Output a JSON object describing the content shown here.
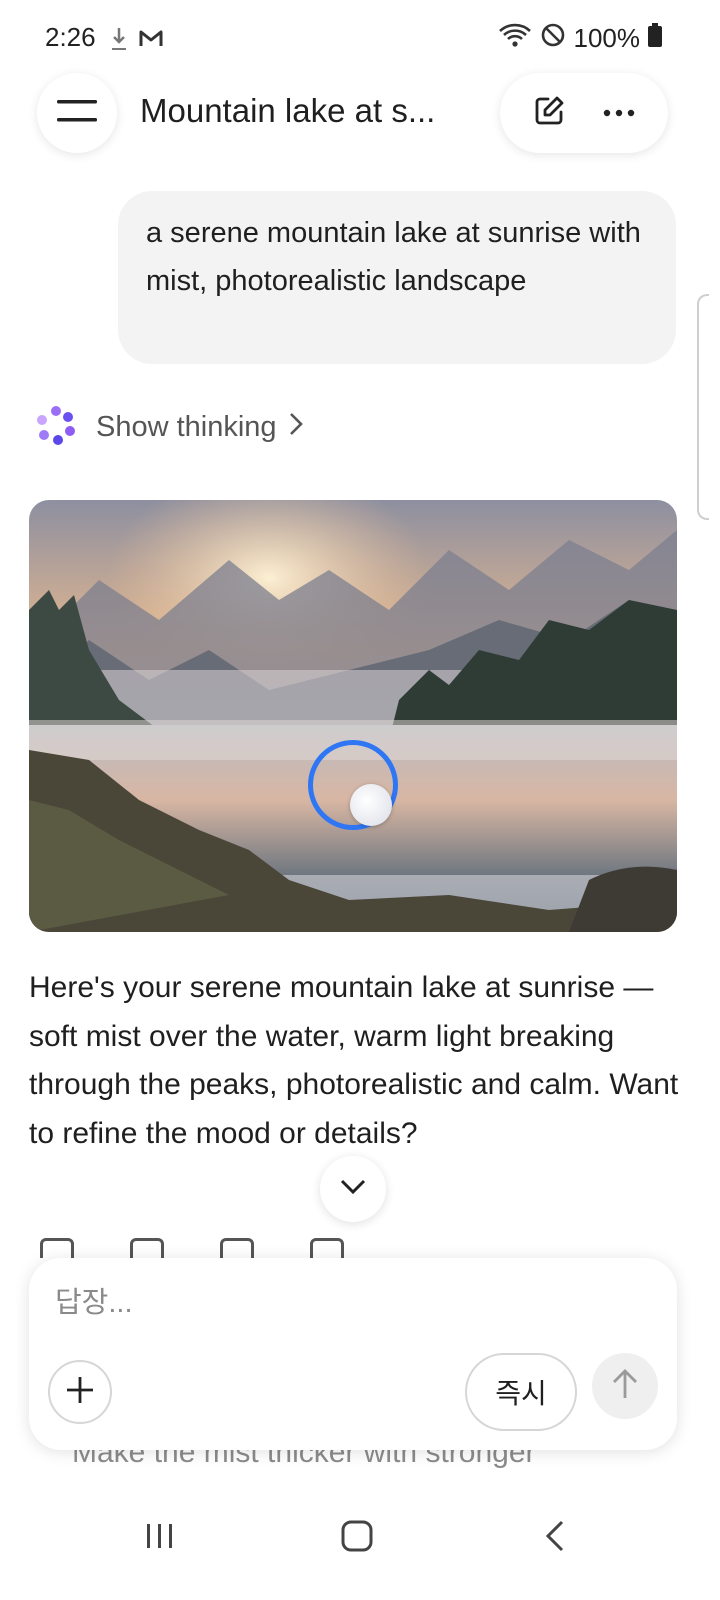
{
  "status_bar": {
    "time": "2:26",
    "battery": "100%"
  },
  "header": {
    "title": "Mountain lake at s...",
    "icons": {
      "menu": "menu-icon",
      "new_chat": "edit-icon",
      "more": "more-icon"
    }
  },
  "conversation": {
    "user_prompt": "a serene mountain lake at sunrise with mist, photorealistic landscape",
    "thinking_label": "Show thinking",
    "response": "Here's your serene mountain lake at sunrise — soft mist over the water, warm light breaking through the peaks, photorealistic and calm. Want to refine the mood or details?"
  },
  "composer": {
    "placeholder": "답장...",
    "instant_label": "즉시"
  },
  "suggestion": "Make the mist thicker with stronger",
  "colors": {
    "accent": "#2f76f5",
    "bubble": "#f3f3f3",
    "gemini_spark": "#7b4df2"
  }
}
